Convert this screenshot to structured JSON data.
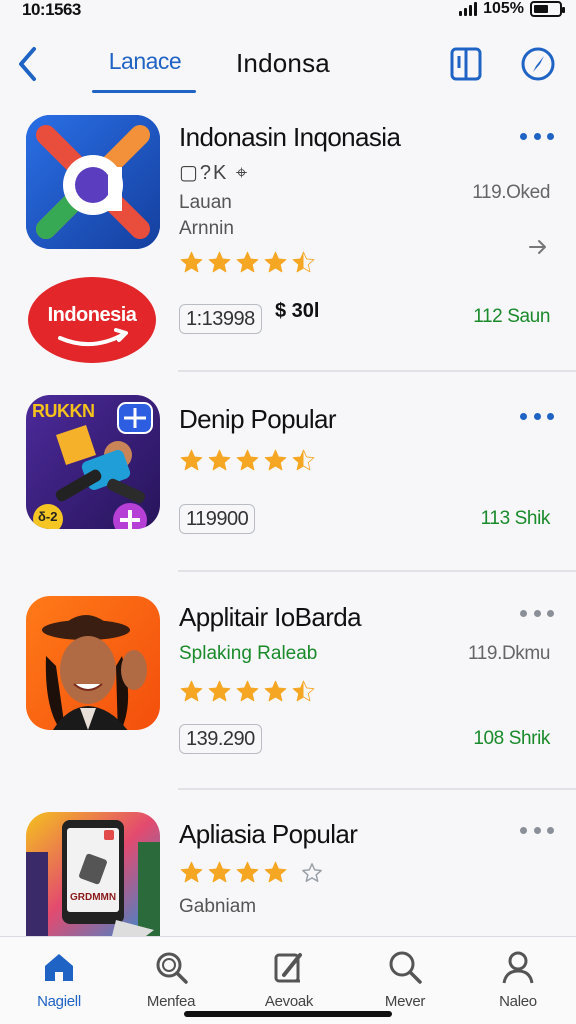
{
  "status_bar": {
    "time": "10:1563",
    "battery": "105%"
  },
  "header": {
    "active_tab": "Lanace",
    "title": "Indonsa"
  },
  "apps": [
    {
      "title": "Indonasin Inqonasia",
      "feature_glyphs": "▢?K ⌖",
      "sub1": "Lauan",
      "sub2": "Arnnin",
      "meta_right": "119.Oked",
      "count": "1:13998",
      "price": "$ 30l",
      "green": "112 Saun",
      "rating": 4.5,
      "brand_label": "Indonesia"
    },
    {
      "title": "Denip Popular",
      "count": "119900",
      "green": "113 Shik",
      "rating": 4.5,
      "game_badge": "RUKKN",
      "game_corner": "δ-2"
    },
    {
      "title": "Applitair IoBarda",
      "green_sub": "Splaking Raleab",
      "meta_right": "119.Dkmu",
      "count": "139.290",
      "green": "108 Shrik",
      "rating": 4.5
    },
    {
      "title": "Apliasia Popular",
      "sub1": "Gabniam",
      "rating": 4,
      "screen_text": "GRDMMN"
    }
  ],
  "tabbar": [
    {
      "label": "Nagiell",
      "icon": "home-icon"
    },
    {
      "label": "Menfea",
      "icon": "search-icon"
    },
    {
      "label": "Aevoak",
      "icon": "apps-icon"
    },
    {
      "label": "Mever",
      "icon": "search-icon"
    },
    {
      "label": "Naleo",
      "icon": "profile-icon"
    }
  ],
  "colors": {
    "accent": "#1f63c5",
    "green": "#1a8a2b",
    "star": "#f5a623",
    "star_empty": "#9aa0a8"
  }
}
